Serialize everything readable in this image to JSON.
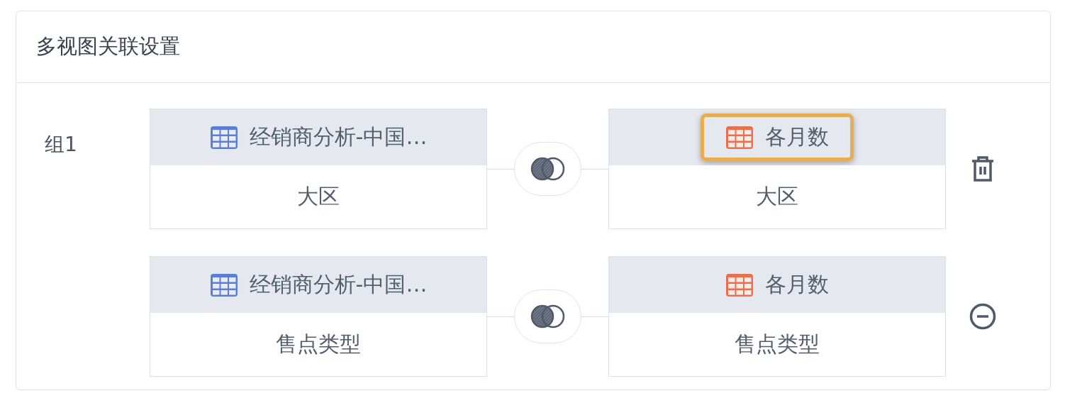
{
  "panel": {
    "title": "多视图关联设置"
  },
  "groups": [
    {
      "label": "组1",
      "pairs": [
        {
          "left": {
            "title": "经销商分析-中国…",
            "color": "#5b7fd6",
            "field": "大区",
            "highlighted": false
          },
          "right": {
            "title": "各月数",
            "color": "#e8704f",
            "field": "大区",
            "highlighted": true
          },
          "action": {
            "kind": "delete"
          }
        },
        {
          "left": {
            "title": "经销商分析-中国…",
            "color": "#5b7fd6",
            "field": "售点类型",
            "highlighted": false
          },
          "right": {
            "title": "各月数",
            "color": "#e8704f",
            "field": "售点类型",
            "highlighted": false
          },
          "action": {
            "kind": "remove"
          }
        }
      ]
    }
  ]
}
